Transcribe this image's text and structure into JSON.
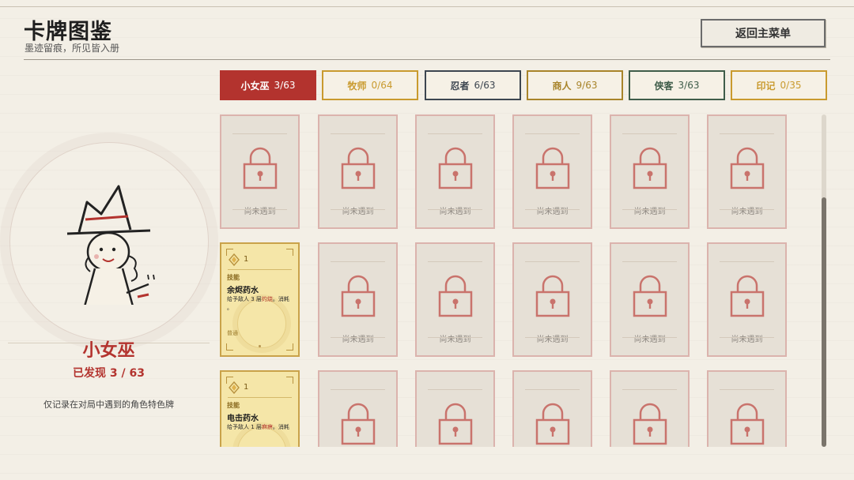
{
  "header": {
    "title": "卡牌图鉴",
    "subtitle": "墨迹留痕，所见皆入册",
    "back_label": "返回主菜单"
  },
  "character": {
    "name": "小女巫",
    "progress_label": "已发现 3 / 63",
    "note": "仅记录在对局中遇到的角色特色牌"
  },
  "tabs": [
    {
      "name": "小女巫",
      "count": "3/63",
      "color": "#b3332e",
      "active": true
    },
    {
      "name": "牧师",
      "count": "0/64",
      "color": "#c99a2e",
      "active": false
    },
    {
      "name": "忍者",
      "count": "6/63",
      "color": "#3d4650",
      "active": false
    },
    {
      "name": "商人",
      "count": "9/63",
      "color": "#a8842a",
      "active": false
    },
    {
      "name": "侠客",
      "count": "3/63",
      "color": "#3f5d4a",
      "active": false
    },
    {
      "name": "印记",
      "count": "0/35",
      "color": "#c99a2e",
      "active": false
    }
  ],
  "locked_label": "尚未遇到",
  "found_cards": [
    {
      "cost": "1",
      "type": "技能",
      "name": "余烬药水",
      "desc_pre": "给予敌人 3 层",
      "desc_hl": "灼烧",
      "desc_post": "。消耗",
      "desc_end": "。",
      "rarity": "普通"
    },
    {
      "cost": "1",
      "type": "技能",
      "name": "电击药水",
      "desc_pre": "给予敌人 1 层",
      "desc_hl": "麻痹",
      "desc_post": "。消耗",
      "desc_end": "",
      "rarity": ""
    }
  ],
  "colors": {
    "accent": "#b3332e",
    "locked_border": "#dbb3ad",
    "found_bg": "#f5e6a8",
    "found_border": "#c9a24a"
  },
  "icons": {
    "lock": "lock-icon",
    "cost": "cost-gem-icon"
  }
}
